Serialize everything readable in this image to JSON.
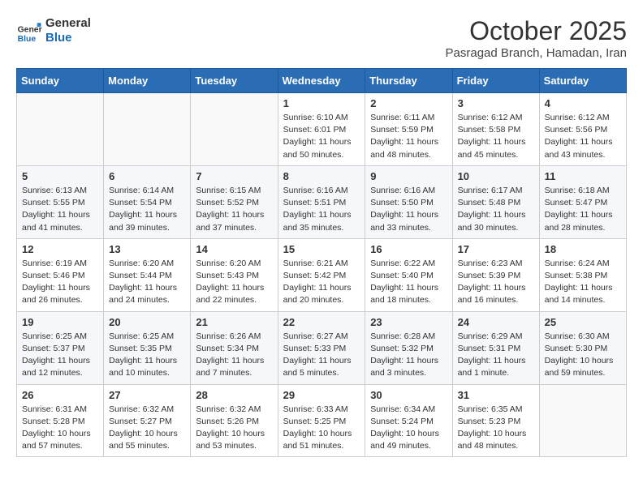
{
  "header": {
    "logo_line1": "General",
    "logo_line2": "Blue",
    "month": "October 2025",
    "location": "Pasragad Branch, Hamadan, Iran"
  },
  "weekdays": [
    "Sunday",
    "Monday",
    "Tuesday",
    "Wednesday",
    "Thursday",
    "Friday",
    "Saturday"
  ],
  "rows": [
    [
      {
        "day": "",
        "content": ""
      },
      {
        "day": "",
        "content": ""
      },
      {
        "day": "",
        "content": ""
      },
      {
        "day": "1",
        "content": "Sunrise: 6:10 AM\nSunset: 6:01 PM\nDaylight: 11 hours\nand 50 minutes."
      },
      {
        "day": "2",
        "content": "Sunrise: 6:11 AM\nSunset: 5:59 PM\nDaylight: 11 hours\nand 48 minutes."
      },
      {
        "day": "3",
        "content": "Sunrise: 6:12 AM\nSunset: 5:58 PM\nDaylight: 11 hours\nand 45 minutes."
      },
      {
        "day": "4",
        "content": "Sunrise: 6:12 AM\nSunset: 5:56 PM\nDaylight: 11 hours\nand 43 minutes."
      }
    ],
    [
      {
        "day": "5",
        "content": "Sunrise: 6:13 AM\nSunset: 5:55 PM\nDaylight: 11 hours\nand 41 minutes."
      },
      {
        "day": "6",
        "content": "Sunrise: 6:14 AM\nSunset: 5:54 PM\nDaylight: 11 hours\nand 39 minutes."
      },
      {
        "day": "7",
        "content": "Sunrise: 6:15 AM\nSunset: 5:52 PM\nDaylight: 11 hours\nand 37 minutes."
      },
      {
        "day": "8",
        "content": "Sunrise: 6:16 AM\nSunset: 5:51 PM\nDaylight: 11 hours\nand 35 minutes."
      },
      {
        "day": "9",
        "content": "Sunrise: 6:16 AM\nSunset: 5:50 PM\nDaylight: 11 hours\nand 33 minutes."
      },
      {
        "day": "10",
        "content": "Sunrise: 6:17 AM\nSunset: 5:48 PM\nDaylight: 11 hours\nand 30 minutes."
      },
      {
        "day": "11",
        "content": "Sunrise: 6:18 AM\nSunset: 5:47 PM\nDaylight: 11 hours\nand 28 minutes."
      }
    ],
    [
      {
        "day": "12",
        "content": "Sunrise: 6:19 AM\nSunset: 5:46 PM\nDaylight: 11 hours\nand 26 minutes."
      },
      {
        "day": "13",
        "content": "Sunrise: 6:20 AM\nSunset: 5:44 PM\nDaylight: 11 hours\nand 24 minutes."
      },
      {
        "day": "14",
        "content": "Sunrise: 6:20 AM\nSunset: 5:43 PM\nDaylight: 11 hours\nand 22 minutes."
      },
      {
        "day": "15",
        "content": "Sunrise: 6:21 AM\nSunset: 5:42 PM\nDaylight: 11 hours\nand 20 minutes."
      },
      {
        "day": "16",
        "content": "Sunrise: 6:22 AM\nSunset: 5:40 PM\nDaylight: 11 hours\nand 18 minutes."
      },
      {
        "day": "17",
        "content": "Sunrise: 6:23 AM\nSunset: 5:39 PM\nDaylight: 11 hours\nand 16 minutes."
      },
      {
        "day": "18",
        "content": "Sunrise: 6:24 AM\nSunset: 5:38 PM\nDaylight: 11 hours\nand 14 minutes."
      }
    ],
    [
      {
        "day": "19",
        "content": "Sunrise: 6:25 AM\nSunset: 5:37 PM\nDaylight: 11 hours\nand 12 minutes."
      },
      {
        "day": "20",
        "content": "Sunrise: 6:25 AM\nSunset: 5:35 PM\nDaylight: 11 hours\nand 10 minutes."
      },
      {
        "day": "21",
        "content": "Sunrise: 6:26 AM\nSunset: 5:34 PM\nDaylight: 11 hours\nand 7 minutes."
      },
      {
        "day": "22",
        "content": "Sunrise: 6:27 AM\nSunset: 5:33 PM\nDaylight: 11 hours\nand 5 minutes."
      },
      {
        "day": "23",
        "content": "Sunrise: 6:28 AM\nSunset: 5:32 PM\nDaylight: 11 hours\nand 3 minutes."
      },
      {
        "day": "24",
        "content": "Sunrise: 6:29 AM\nSunset: 5:31 PM\nDaylight: 11 hours\nand 1 minute."
      },
      {
        "day": "25",
        "content": "Sunrise: 6:30 AM\nSunset: 5:30 PM\nDaylight: 10 hours\nand 59 minutes."
      }
    ],
    [
      {
        "day": "26",
        "content": "Sunrise: 6:31 AM\nSunset: 5:28 PM\nDaylight: 10 hours\nand 57 minutes."
      },
      {
        "day": "27",
        "content": "Sunrise: 6:32 AM\nSunset: 5:27 PM\nDaylight: 10 hours\nand 55 minutes."
      },
      {
        "day": "28",
        "content": "Sunrise: 6:32 AM\nSunset: 5:26 PM\nDaylight: 10 hours\nand 53 minutes."
      },
      {
        "day": "29",
        "content": "Sunrise: 6:33 AM\nSunset: 5:25 PM\nDaylight: 10 hours\nand 51 minutes."
      },
      {
        "day": "30",
        "content": "Sunrise: 6:34 AM\nSunset: 5:24 PM\nDaylight: 10 hours\nand 49 minutes."
      },
      {
        "day": "31",
        "content": "Sunrise: 6:35 AM\nSunset: 5:23 PM\nDaylight: 10 hours\nand 48 minutes."
      },
      {
        "day": "",
        "content": ""
      }
    ]
  ]
}
